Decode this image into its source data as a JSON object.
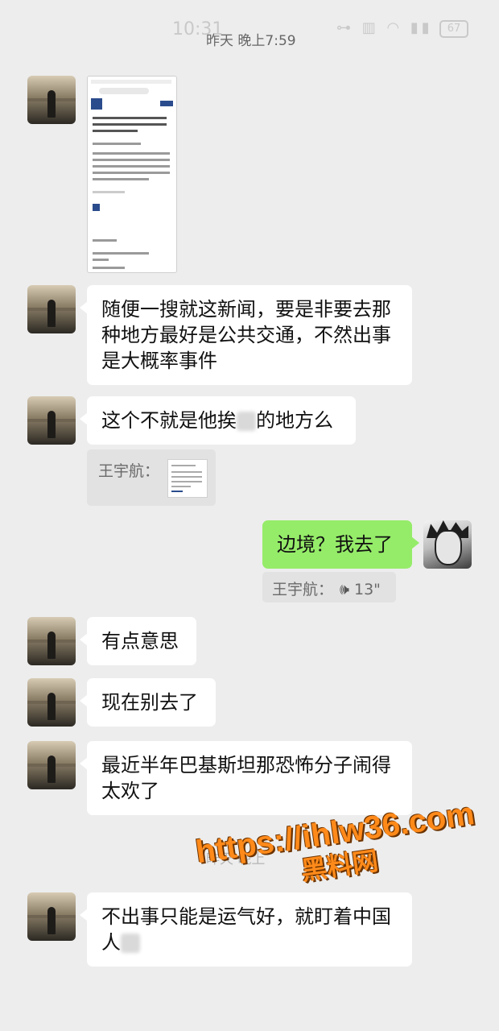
{
  "status_bar": {
    "time": "10:31",
    "date_label": "昨天 晚上7:59",
    "icons": "⊶ ▥ ◠ ▮▮",
    "battery": "67"
  },
  "messages": [
    {
      "sender": "contact",
      "type": "image",
      "content": "news-screenshot"
    },
    {
      "sender": "contact",
      "type": "text",
      "text": "随便一搜就这新闻，要是非要去那种地方最好是公共交通，不然出事是大概率事件"
    },
    {
      "sender": "contact",
      "type": "text",
      "text_before": "这个不就是他挨",
      "text_after": "的地方么"
    },
    {
      "sender": "contact",
      "type": "quote",
      "quote_author": "王宇航："
    },
    {
      "sender": "me",
      "type": "text",
      "text": "边境？我去了"
    },
    {
      "sender": "me",
      "type": "quote_voice",
      "quote_author": "王宇航：",
      "voice_icon": "🕪",
      "duration": "13\""
    },
    {
      "sender": "contact",
      "type": "text",
      "text": "有点意思"
    },
    {
      "sender": "contact",
      "type": "text",
      "text": "现在别去了"
    },
    {
      "sender": "contact",
      "type": "text",
      "text": "最近半年巴基斯坦那恐怖分子闹得太欢了"
    },
    {
      "sender": "contact",
      "type": "text",
      "text_before": "不出事只能是运气好，就盯着中国人",
      "text_after": ""
    }
  ],
  "faded_date": "昨天 晚上",
  "watermark": {
    "url": "https://ihlw36.com",
    "label": "黑料网"
  },
  "colors": {
    "background": "#ededed",
    "my_bubble": "#95ec69",
    "their_bubble": "#ffffff",
    "watermark": "#ff8a1a"
  }
}
